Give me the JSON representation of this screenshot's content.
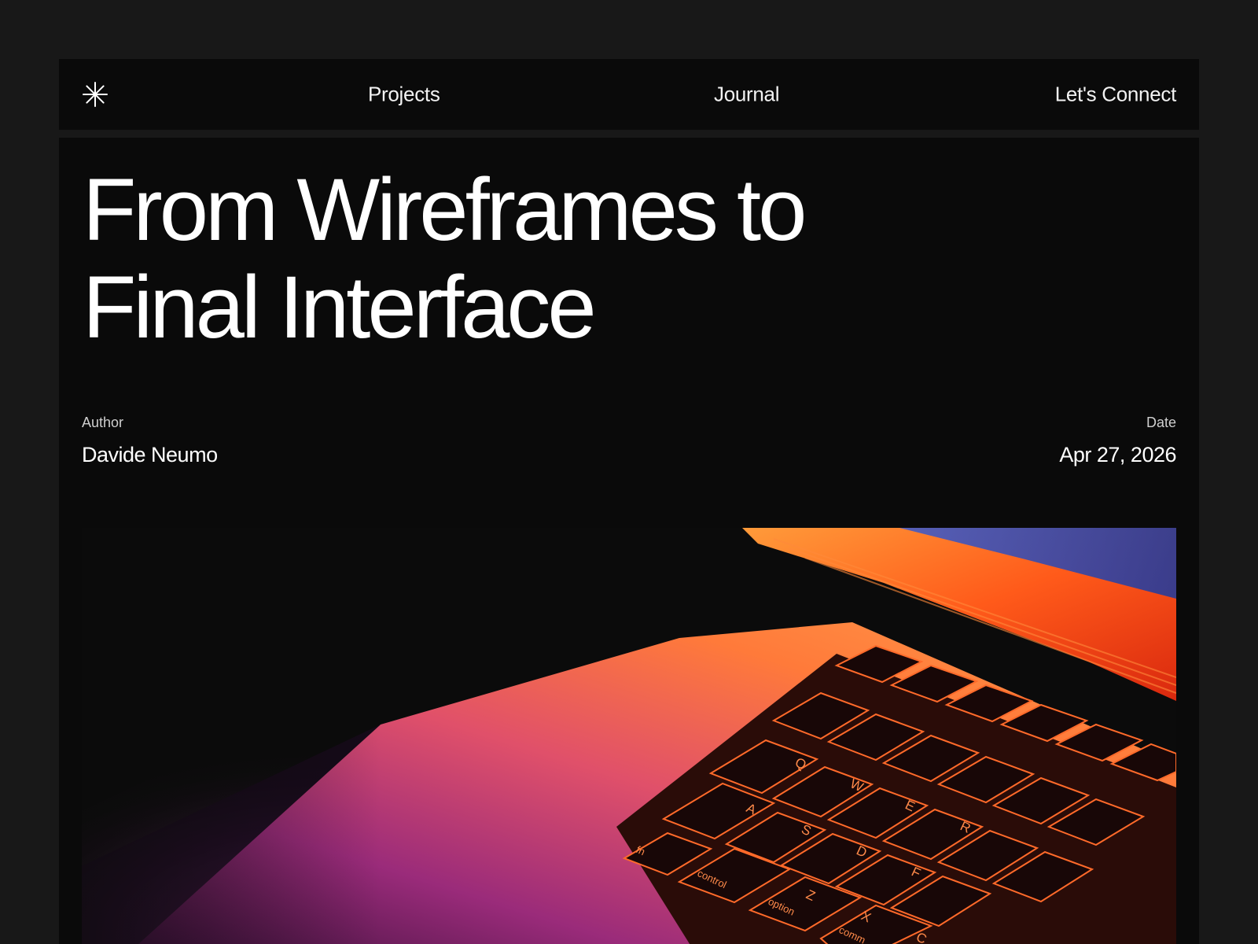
{
  "nav": {
    "logo_icon": "asterisk-icon",
    "links": [
      {
        "label": "Projects"
      },
      {
        "label": "Journal"
      },
      {
        "label": "Let's Connect"
      }
    ]
  },
  "article": {
    "title_line1": "From Wireframes to",
    "title_line2": "Final Interface",
    "author_label": "Author",
    "author_name": "Davide Neumo",
    "date_label": "Date",
    "date_value": "Apr 27, 2026"
  },
  "hero": {
    "keys_row1": [
      "Q",
      "W",
      "E",
      "R"
    ],
    "keys_row2": [
      "A",
      "S",
      "D",
      "F"
    ],
    "keys_row3": [
      "Z",
      "X",
      "C"
    ],
    "mod_keys": [
      "fn",
      "control",
      "option",
      "comm"
    ]
  },
  "colors": {
    "page_bg": "#181818",
    "panel_bg": "#0a0a0a",
    "text": "#ffffff",
    "accent_orange": "#ff7a1a",
    "accent_purple": "#b0308a"
  }
}
